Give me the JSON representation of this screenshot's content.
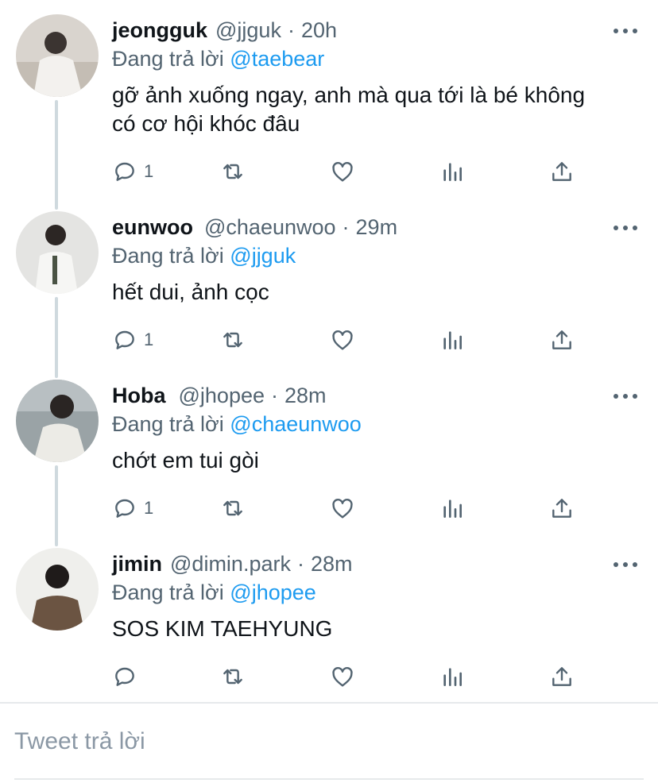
{
  "reply_prefix": "Đang trả lời",
  "tweets": [
    {
      "name": "jeongguk",
      "handle": "@jjguk",
      "time": "20h",
      "reply_to": "@taebear",
      "text_lines": [
        "gỡ ảnh xuống ngay, anh mà qua tới là bé không",
        "có cơ hội khóc đâu"
      ],
      "reply_count": "1"
    },
    {
      "name": "eunwoo",
      "handle": "@chaeunwoo",
      "time": "29m",
      "reply_to": "@jjguk",
      "text_lines": [
        "hết dui, ảnh cọc"
      ],
      "reply_count": "1"
    },
    {
      "name": "Hoba",
      "handle": "@jhopee",
      "time": "28m",
      "reply_to": "@chaeunwoo",
      "text_lines": [
        "chớt em tui gòi"
      ],
      "reply_count": "1"
    },
    {
      "name": "jimin",
      "handle": "@dimin.park",
      "time": "28m",
      "reply_to": "@jhopee",
      "text_lines": [
        "SOS KIM TAEHYUNG"
      ],
      "reply_count": ""
    }
  ],
  "icons": {
    "reply": "reply-icon",
    "retweet": "retweet-icon",
    "like": "heart-icon",
    "analytics": "analytics-icon",
    "share": "share-icon",
    "more": "more-icon"
  },
  "colors": {
    "link": "#1d9bf0",
    "muted": "#536471",
    "thread_line": "#cfd9de"
  },
  "compose": {
    "placeholder": "Tweet trả lời"
  }
}
